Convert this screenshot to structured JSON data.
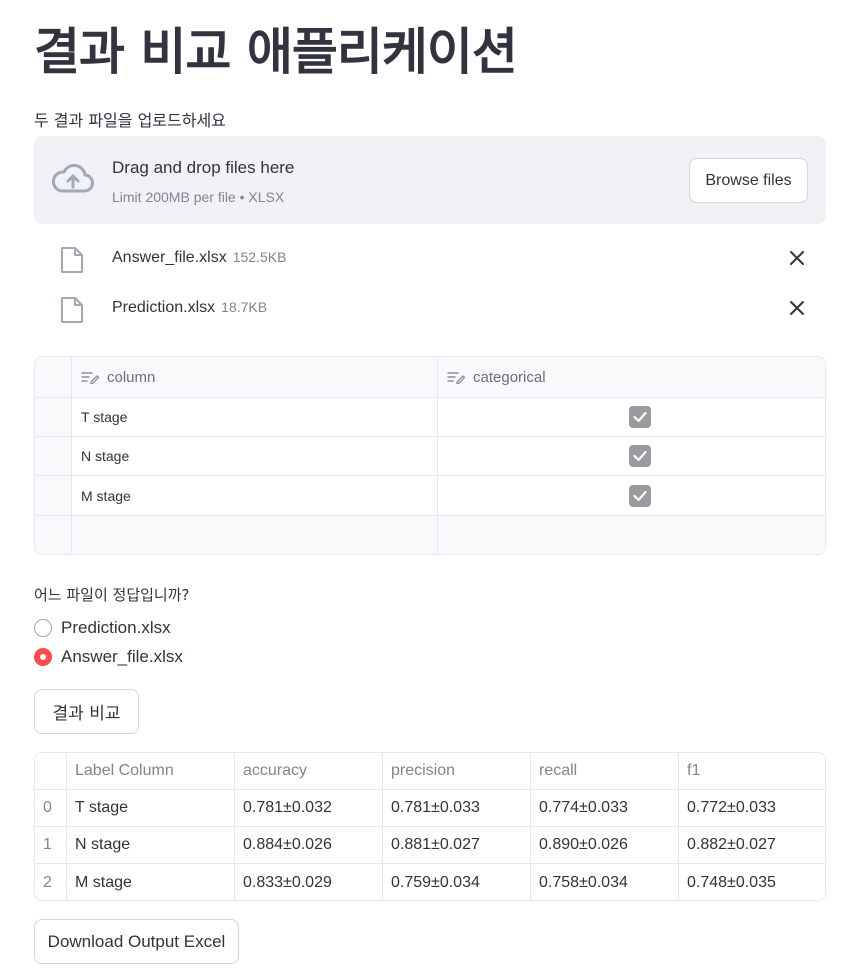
{
  "page": {
    "title": "결과 비교 애플리케이션"
  },
  "uploader": {
    "label": "두 결과 파일을 업로드하세요",
    "drag_text": "Drag and drop files here",
    "limit_text": "Limit 200MB per file • XLSX",
    "browse_label": "Browse files",
    "icon": "cloud-upload-icon",
    "files": [
      {
        "name": "Answer_file.xlsx",
        "size": "152.5KB"
      },
      {
        "name": "Prediction.xlsx",
        "size": "18.7KB"
      }
    ]
  },
  "editor": {
    "headers": [
      "column",
      "categorical"
    ],
    "rows": [
      {
        "column": "T stage",
        "categorical": true
      },
      {
        "column": "N stage",
        "categorical": true
      },
      {
        "column": "M stage",
        "categorical": true
      }
    ]
  },
  "radio": {
    "question": "어느 파일이 정답입니까?",
    "options": [
      "Prediction.xlsx",
      "Answer_file.xlsx"
    ],
    "selected_index": 1
  },
  "compare_button": "결과 비교",
  "results": {
    "headers": [
      "",
      "Label Column",
      "accuracy",
      "precision",
      "recall",
      "f1"
    ],
    "rows": [
      [
        "0",
        "T stage",
        "0.781±0.032",
        "0.781±0.033",
        "0.774±0.033",
        "0.772±0.033"
      ],
      [
        "1",
        "N stage",
        "0.884±0.026",
        "0.881±0.027",
        "0.890±0.026",
        "0.882±0.027"
      ],
      [
        "2",
        "M stage",
        "0.833±0.029",
        "0.759±0.034",
        "0.758±0.034",
        "0.748±0.035"
      ]
    ]
  },
  "download_button": "Download Output Excel",
  "colors": {
    "accent": "#ff4b4b",
    "text": "#31333f",
    "muted": "#808495",
    "dropzone_bg": "#f0f2f6"
  }
}
